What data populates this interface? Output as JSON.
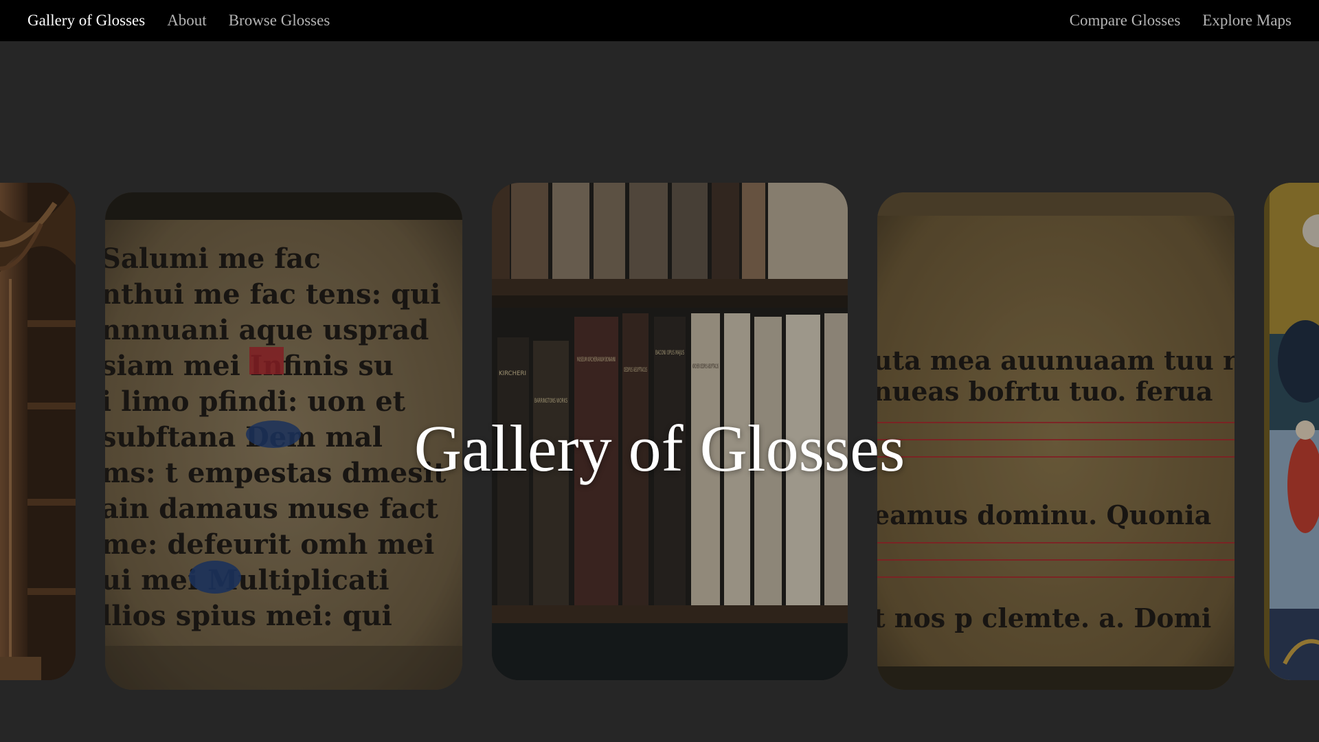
{
  "nav": {
    "brand": "Gallery of Glosses",
    "about": "About",
    "browse": "Browse Glosses",
    "compare": "Compare Glosses",
    "explore": "Explore Maps"
  },
  "hero": {
    "title": "Gallery of Glosses"
  },
  "carousel": {
    "manuscript_lines": [
      "Salumi me fac",
      "nthui me fac tens: qui",
      "nnnuani aque usprad",
      "siam mei Infinis su",
      "i limo pfindi: uon et",
      "subftana Dem mal",
      "ms: t empestas dmesit",
      "ain damaus muse fact",
      "me: defeurit omh mei",
      "ui mei Multiplicati",
      "llios spius mei: qui"
    ],
    "chant_lines": [
      "uta mea auunuaam tuu re po",
      "nueas bofrtu tuo. ferua",
      "eamus dominu. Quonia",
      "t nos p clemte. a. Domi"
    ],
    "book_spine_labels": [
      "MUSEUM KIRCHERIANUM BONANNI",
      "OEDIPUS AEGYPTIACUS",
      "KIRCHERI OEDIPUS AEGYPTIACUS",
      "BARRINGTONS WORKS",
      "KIRCHERI",
      "BACONI OPUS MAJUS"
    ],
    "colors": {
      "parchment": "#8a7758",
      "ink": "#1a1612",
      "rubric_red": "#b2222a",
      "initial_blue": "#1f3e7a",
      "wood": "#5a3a20"
    }
  }
}
